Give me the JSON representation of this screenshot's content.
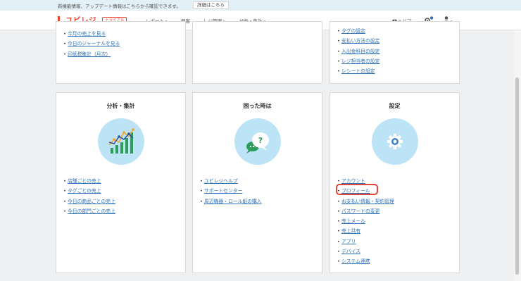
{
  "notice": {
    "text": "新機能情報、アップデート情報はこちらから確認できます。",
    "button": "詳細はこちら"
  },
  "nav": {
    "logo": "ユビレジ",
    "trial_badge": "トライアル",
    "items": [
      {
        "label": "レポート",
        "has_caret": true
      },
      {
        "label": "顧客",
        "has_caret": false
      },
      {
        "label": "レジ管理",
        "has_caret": true
      },
      {
        "label": "分析・集計",
        "has_caret": true
      }
    ],
    "help": "ヘルプ",
    "caret": "▾",
    "notification_badge_color": "#2f72b7"
  },
  "top_cards": {
    "left": [
      "今月の売上を見る",
      "今日のジャーナルを見る",
      "印紙税集計（月次）"
    ],
    "right": [
      "タグの設定",
      "支払い方法の設定",
      "入出金科目の設定",
      "レジ担当者の設定",
      "レシートの設定"
    ]
  },
  "cards": [
    {
      "title": "分析・集計",
      "icon": "analytics-chart-icon",
      "links": [
        "店舗ごとの売上",
        "タグごとの売上",
        "今日の商品ごとの売上",
        "今日の部門ごとの売上"
      ]
    },
    {
      "title": "困った時は",
      "icon": "help-bubble-icon",
      "links": [
        "ユビレジヘルプ",
        "サポートセンター",
        "周辺機器・ロール紙の購入"
      ]
    },
    {
      "title": "設定",
      "icon": "gear-icon",
      "links": [
        "アカウント",
        "プロフィール",
        "お支払い情報・契約管理",
        "パスワードの変更",
        "売上メール",
        "売上共有",
        "アプリ",
        "デバイス",
        "システム連携"
      ],
      "highlighted": "プロフィール"
    }
  ],
  "colors": {
    "brand": "#e8412c",
    "link": "#2f72b7",
    "icon_bg": "#bde3f6",
    "highlight": "#e2453a"
  }
}
